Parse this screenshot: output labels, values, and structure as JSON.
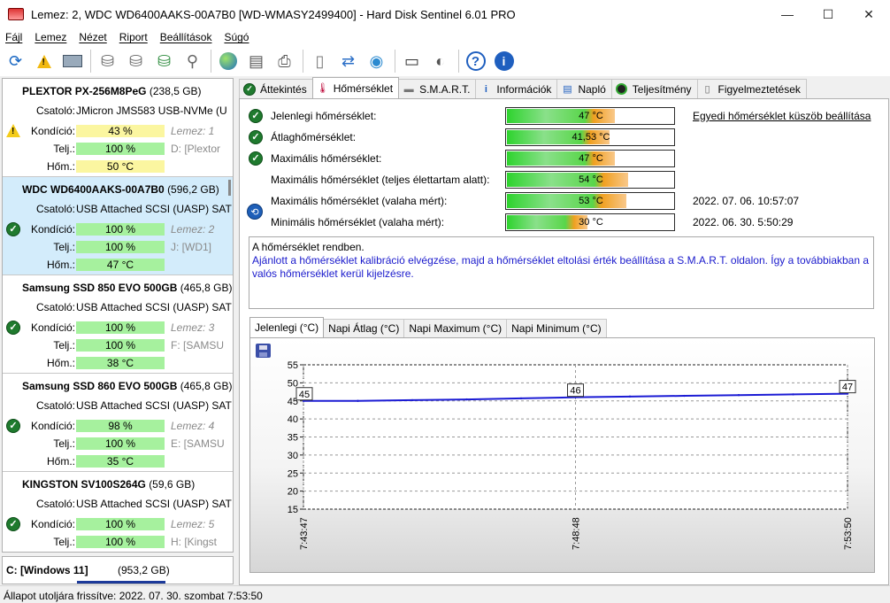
{
  "window": {
    "title": "Lemez: 2, WDC WD6400AAKS-00A7B0 [WD-WMASY2499400]  -  Hard Disk Sentinel 6.01 PRO",
    "minimize": "—",
    "maximize": "☐",
    "close": "✕"
  },
  "menu": [
    "Fájl",
    "Lemez",
    "Nézet",
    "Riport",
    "Beállítások",
    "Súgó"
  ],
  "toolbar": {
    "icons": [
      "refresh-icon",
      "alert-icon",
      "disk-info-icon",
      "disk-test-icon",
      "surface-test-icon",
      "check-disk-icon",
      "search-disk-icon",
      "web-icon",
      "send-report-icon",
      "print-icon",
      "document-icon",
      "sync-icon",
      "network-icon",
      "laptop-icon",
      "sound-icon",
      "help-icon",
      "info-icon"
    ]
  },
  "disks": [
    {
      "name": "PLEXTOR PX-256M8PeG",
      "size": "(238,5 GB)",
      "conn_label": "Csatoló:",
      "conn": "JMicron JMS583 USB-NVMe (U",
      "health_label": "Kondíció:",
      "health": "43 %",
      "health_color": "yellow",
      "health_side": "Lemez: 1",
      "perf_label": "Telj.:",
      "perf": "100 %",
      "perf_side": "D: [Plextor",
      "temp_label": "Hőm.:",
      "temp": "50 °C",
      "temp_color": "yellow",
      "status": "warning",
      "selected": false
    },
    {
      "name": "WDC WD6400AAKS-00A7B0",
      "size": "(596,2 GB)",
      "conn_label": "Csatoló:",
      "conn": "USB Attached SCSI (UASP) SAT",
      "health_label": "Kondíció:",
      "health": "100 %",
      "health_color": "green",
      "health_side": "Lemez: 2",
      "perf_label": "Telj.:",
      "perf": "100 %",
      "perf_side": "J: [WD1]",
      "temp_label": "Hőm.:",
      "temp": "47 °C",
      "temp_color": "green",
      "status": "ok",
      "selected": true
    },
    {
      "name": "Samsung SSD 850 EVO 500GB",
      "size": "(465,8 GB)",
      "conn_label": "Csatoló:",
      "conn": "USB Attached SCSI (UASP) SAT",
      "health_label": "Kondíció:",
      "health": "100 %",
      "health_color": "green",
      "health_side": "Lemez: 3",
      "perf_label": "Telj.:",
      "perf": "100 %",
      "perf_side": "F: [SAMSU",
      "temp_label": "Hőm.:",
      "temp": "38 °C",
      "temp_color": "green",
      "status": "ok",
      "selected": false
    },
    {
      "name": "Samsung SSD 860 EVO 500GB",
      "size": "(465,8 GB)",
      "conn_label": "Csatoló:",
      "conn": "USB Attached SCSI (UASP) SAT",
      "health_label": "Kondíció:",
      "health": "98 %",
      "health_color": "green",
      "health_side": "Lemez: 4",
      "perf_label": "Telj.:",
      "perf": "100 %",
      "perf_side": "E: [SAMSU",
      "temp_label": "Hőm.:",
      "temp": "35 °C",
      "temp_color": "green",
      "status": "ok",
      "selected": false
    },
    {
      "name": "KINGSTON SV100S264G",
      "size": "(59,6 GB)",
      "conn_label": "Csatoló:",
      "conn": "USB Attached SCSI (UASP) SAT",
      "health_label": "Kondíció:",
      "health": "100 %",
      "health_color": "green",
      "health_side": "Lemez: 5",
      "perf_label": "Telj.:",
      "perf": "100 %",
      "perf_side": "H: [Kingst",
      "temp_label": "",
      "temp": "",
      "temp_color": "green",
      "status": "ok",
      "selected": false
    }
  ],
  "partition": {
    "name": "C: [Windows 11]",
    "size": "(953,2 GB)"
  },
  "status_bar": "Állapot utoljára frissítve: 2022. 07. 30. szombat 7:53:50",
  "tabs": [
    {
      "label": "Áttekintés",
      "icon": "check-icon",
      "active": false
    },
    {
      "label": "Hőmérséklet",
      "icon": "thermometer-icon",
      "active": true
    },
    {
      "label": "S.M.A.R.T.",
      "icon": "drive-icon",
      "active": false
    },
    {
      "label": "Információk",
      "icon": "info-icon",
      "active": false
    },
    {
      "label": "Napló",
      "icon": "log-icon",
      "active": false
    },
    {
      "label": "Teljesítmény",
      "icon": "gauge-icon",
      "active": false
    },
    {
      "label": "Figyelmeztetések",
      "icon": "alerts-icon",
      "active": false
    }
  ],
  "temps": [
    {
      "label": "Jelenlegi hőmérséklet:",
      "value": "47 °C",
      "fraction": 0.64,
      "ok": true,
      "extra": "Egyedi hőmérséklet küszöb beállítása",
      "extra_link": true
    },
    {
      "label": "Átlaghőmérséklet:",
      "value": "41,53 °C",
      "fraction": 0.61,
      "ok": true,
      "extra": "",
      "extra_link": false
    },
    {
      "label": "Maximális hőmérséklet:",
      "value": "47 °C",
      "fraction": 0.64,
      "ok": true,
      "extra": "",
      "extra_link": false
    },
    {
      "label": "Maximális hőmérséklet (teljes élettartam alatt):",
      "value": "54 °C",
      "fraction": 0.72,
      "ok": false,
      "extra": "",
      "extra_link": false
    },
    {
      "label": "Maximális hőmérséklet (valaha mért):",
      "value": "53 °C",
      "fraction": 0.71,
      "ok": false,
      "extra": "2022. 07. 06. 10:57:07",
      "extra_link": false
    },
    {
      "label": "Minimális hőmérséklet (valaha mért):",
      "value": "30 °C",
      "fraction": 0.48,
      "ok": false,
      "extra": "2022. 06. 30. 5:50:29",
      "extra_link": false
    }
  ],
  "message": {
    "line1": "A hőmérséklet rendben.",
    "line2": "Ajánlott a hőmérséklet kalibráció elvégzése, majd a hőmérséklet eltolási érték beállítása a S.M.A.R.T. oldalon. Így a továbbiakban a valós hőmérséklet kerül kijelzésre."
  },
  "graph_tabs": [
    "Jelenlegi (°C)",
    "Napi Átlag (°C)",
    "Napi Maximum (°C)",
    "Napi Minimum (°C)"
  ],
  "colors": {
    "accent": "#1a1acc",
    "line": "#1b1bd4",
    "ok": "#1f7a2e",
    "warn": "#f4cc1a"
  },
  "chart_data": {
    "type": "line",
    "ylim": [
      15,
      55
    ],
    "yticks": [
      "55",
      "50",
      "45",
      "40",
      "35",
      "30",
      "25",
      "20",
      "15"
    ],
    "x": [
      "7:43:47",
      "7:44:47",
      "7:45:47",
      "7:46:47",
      "7:47:47",
      "7:48:48",
      "7:49:49",
      "7:50:49",
      "7:51:50",
      "7:52:50",
      "7:53:50"
    ],
    "xticks": [
      "7:43:47",
      "7:48:48",
      "7:53:50"
    ],
    "values": [
      45,
      45,
      45.2,
      45.4,
      45.7,
      46,
      46.2,
      46.4,
      46.6,
      46.8,
      47
    ],
    "labels": [
      {
        "x": "7:43:47",
        "text": "45"
      },
      {
        "x": "7:48:48",
        "text": "46"
      },
      {
        "x": "7:53:50",
        "text": "47"
      }
    ],
    "grid": true
  }
}
